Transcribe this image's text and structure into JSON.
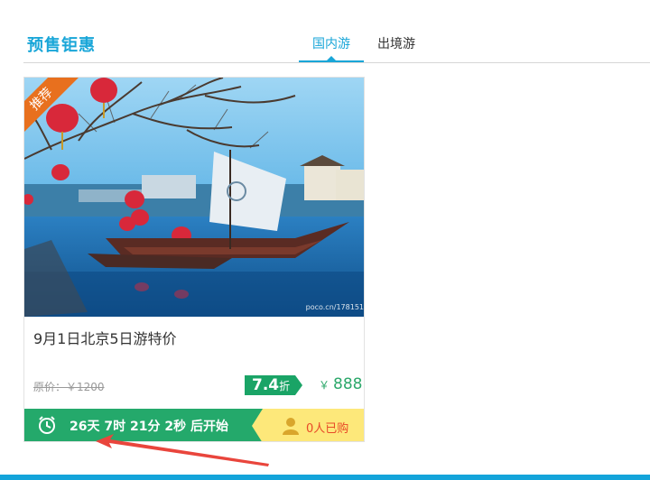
{
  "section": {
    "title": "预售钜惠"
  },
  "tabs": [
    {
      "label": "国内游",
      "active": true
    },
    {
      "label": "出境游",
      "active": false
    }
  ],
  "card": {
    "badge": "推荐",
    "photo_watermark": "poco.cn/178151",
    "title": "9月1日北京5日游特价",
    "original_price_label": "原价：￥1200",
    "discount_value": "7.4",
    "discount_unit": "折",
    "currency": "￥",
    "price": "888",
    "countdown": "26天 7时 21分 2秒 后开始",
    "sold_text": "0人已购",
    "icons": {
      "clock": "alarm-clock-icon",
      "person": "person-icon"
    }
  },
  "colors": {
    "accent": "#19a6d8",
    "badge": "#e8701e",
    "discount": "#1aa466",
    "countdown_bar": "#24a96b",
    "sold_bg": "#fde87a",
    "sold_text": "#e84a28",
    "annotation_arrow": "#e9453c"
  }
}
